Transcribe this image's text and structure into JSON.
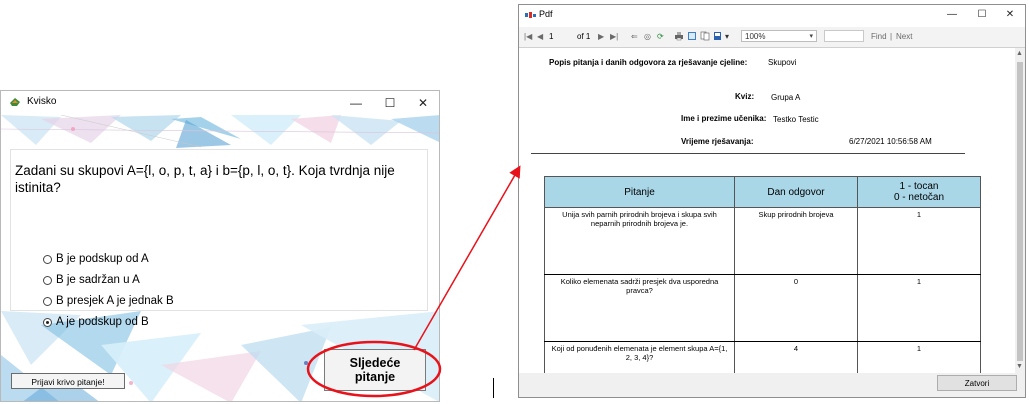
{
  "kvisko": {
    "title": "Kvisko",
    "question": "Zadani su skupovi A={l, o, p, t, a} i b={p, l, o, t}. Koja tvrdnja nije istinita?",
    "options": [
      {
        "label": "B je podskup od A",
        "checked": false
      },
      {
        "label": "B je sadržan u A",
        "checked": false
      },
      {
        "label": "B presjek A je jednak B",
        "checked": false
      },
      {
        "label": "A je podskup od B",
        "checked": true
      }
    ],
    "report_button": "Prijavi krivo pitanje!",
    "next_button_line1": "Sljedeće",
    "next_button_line2": "pitanje"
  },
  "pdf": {
    "title": "Pdf",
    "toolbar": {
      "page_current": "1",
      "page_of": "of 1",
      "zoom": "100%",
      "find": "Find",
      "separator": "|",
      "next": "Next"
    },
    "report": {
      "heading_label": "Popis pitanja i danih odgovora za rješavanje cjeline:",
      "heading_value": "Skupovi",
      "quiz_label": "Kviz:",
      "quiz_value": "Grupa A",
      "student_label": "Ime i prezime učenika:",
      "student_value": "Testko Testic",
      "time_label": "Vrijeme rješavanja:",
      "time_value": "6/27/2021 10:56:58 AM"
    },
    "table": {
      "headers": [
        "Pitanje",
        "Dan odgovor",
        "1 - tocan",
        "0 - netočan"
      ],
      "rows": [
        {
          "question": "Unija svih parnih prirodnih brojeva i skupa svih neparnih prirodnih brojeva je.",
          "answer": "Skup prirodnih brojeva",
          "score": "1"
        },
        {
          "question": "Koliko elemenata sadrži presjek dva usporedna pravca?",
          "answer": "0",
          "score": "1"
        },
        {
          "question": "Koji od ponuđenih elemenata je element skupa A={1, 2, 3, 4}?",
          "answer": "4",
          "score": "1"
        }
      ]
    },
    "close_button": "Zatvori"
  },
  "colors": {
    "table_header": "#aad7e8",
    "annotation": "#e8121a",
    "kvisko_icon": "#3c8a3a"
  }
}
